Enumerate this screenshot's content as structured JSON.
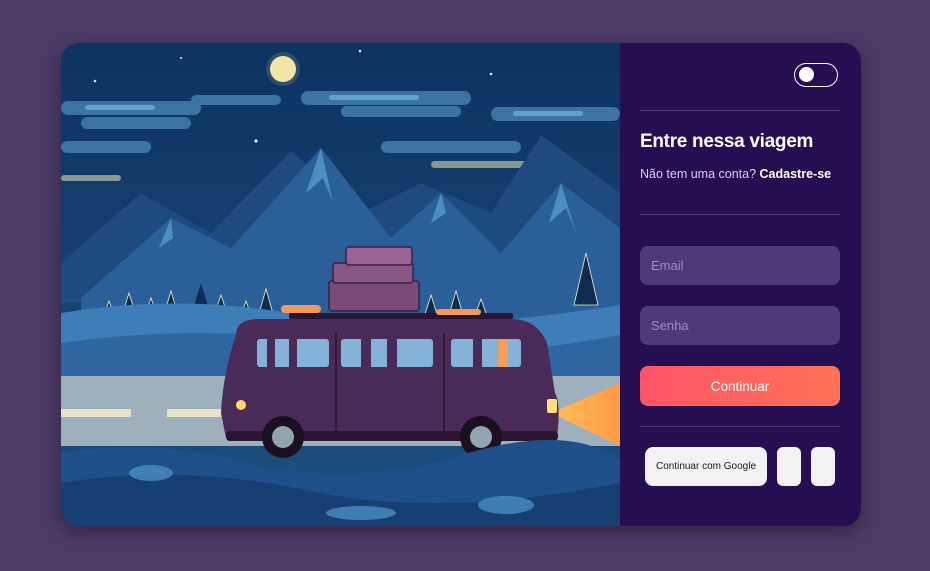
{
  "login": {
    "title": "Entre nessa viagem",
    "subtitle_prefix": "Não tem uma conta?",
    "signup_link": "Cadastre-se",
    "email_placeholder": "Email",
    "password_placeholder": "Senha",
    "continue_label": "Continuar",
    "google_label": "Continuar com Google"
  },
  "theme_toggle": {
    "state": "off"
  },
  "colors": {
    "page_background": "#4b3a66",
    "panel_background": "#250f52",
    "input_background": "#4c3b78",
    "button_gradient_start": "#ff5466",
    "button_gradient_end": "#ff7257"
  }
}
